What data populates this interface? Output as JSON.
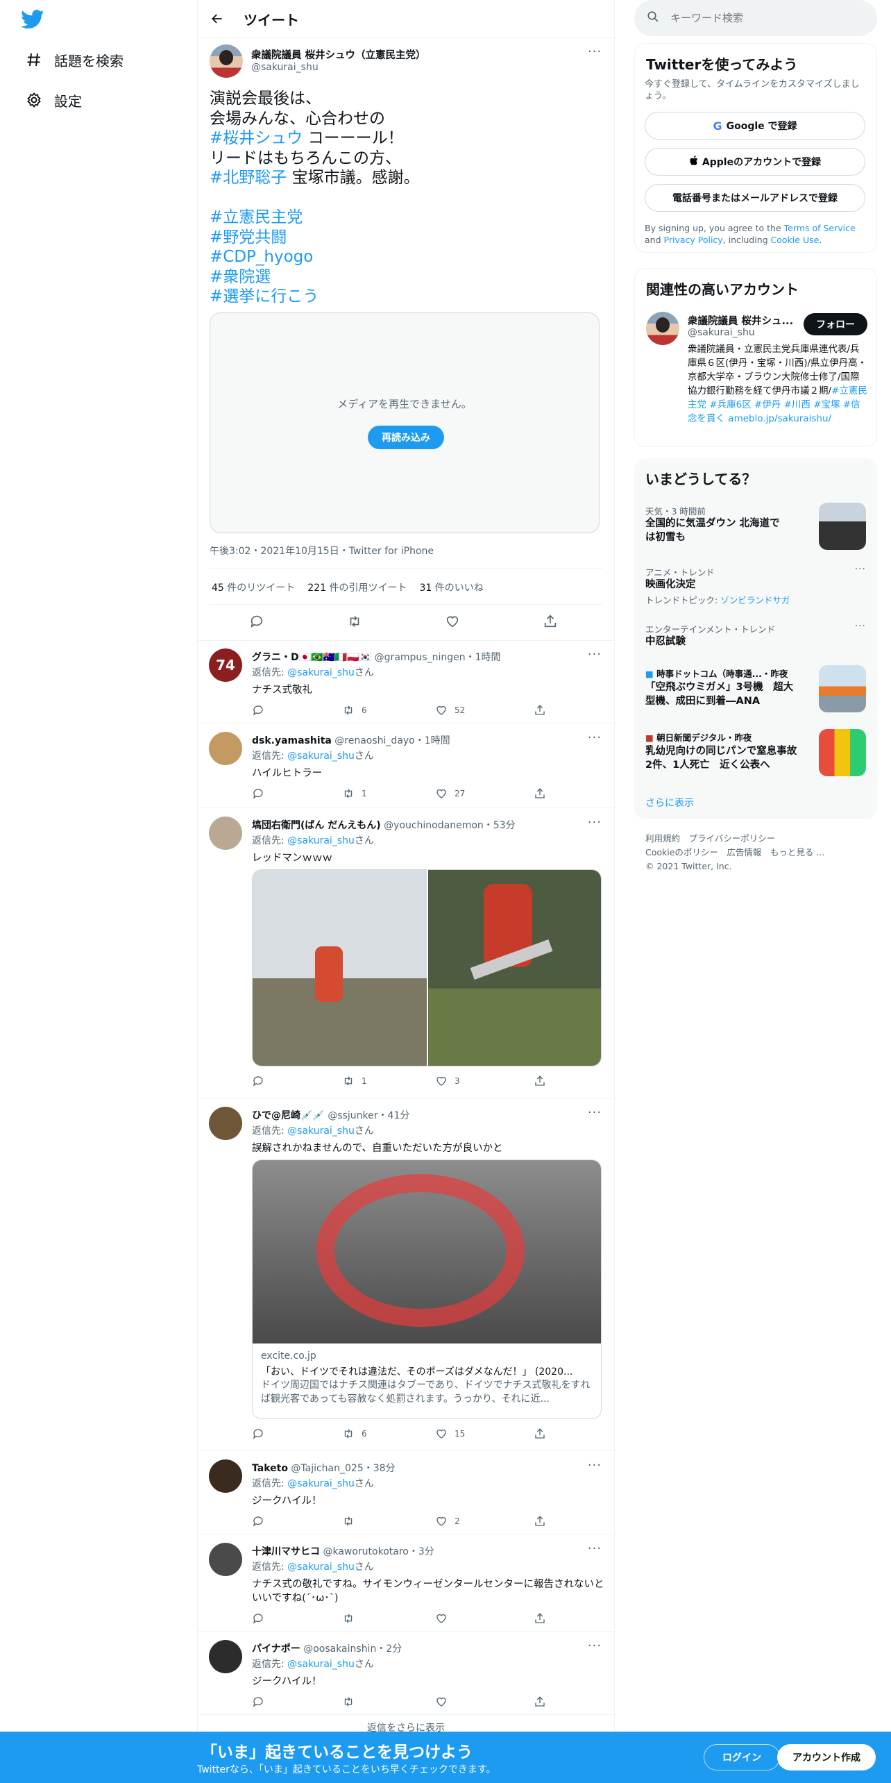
{
  "colors": {
    "brand": "#1d9bf0",
    "text": "#0f1419",
    "muted": "#536471",
    "bar": "#1d9bf0"
  },
  "nav": {
    "logo_icon": "twitter-bird-icon",
    "items": [
      {
        "icon": "hashtag-icon",
        "label": "話題を検索"
      },
      {
        "icon": "gear-icon",
        "label": "設定"
      }
    ]
  },
  "header": {
    "title": "ツイート",
    "back_icon": "arrow-left-icon"
  },
  "tweet": {
    "name": "衆議院議員 桜井シュウ（立憲民主党）",
    "handle": "@sakurai_shu",
    "body": [
      [
        {
          "t": "演説会最後は、"
        }
      ],
      [
        {
          "t": "会場みんな、心合わせの"
        }
      ],
      [
        {
          "t": "#桜井シュウ",
          "l": true
        },
        {
          "t": " コーーール！"
        }
      ],
      [
        {
          "t": "リードはもちろんこの方、"
        }
      ],
      [
        {
          "t": "#北野聡子",
          "l": true
        },
        {
          "t": " 宝塚市議。感謝。"
        }
      ],
      [
        {
          "t": ""
        }
      ],
      [
        {
          "t": "#立憲民主党",
          "l": true
        }
      ],
      [
        {
          "t": "#野党共闘",
          "l": true
        }
      ],
      [
        {
          "t": "#CDP_hyogo",
          "l": true
        }
      ],
      [
        {
          "t": "#衆院選",
          "l": true
        }
      ],
      [
        {
          "t": "#選挙に行こう",
          "l": true
        }
      ]
    ],
    "media_message": "メディアを再生できません。",
    "reload_label": "再読み込み",
    "meta": "午後3:02・2021年10月15日・Twitter for iPhone",
    "retweets": "45",
    "retweets_label": "件のリツイート",
    "quotes": "221",
    "quotes_label": "件の引用ツイート",
    "likes": "31",
    "likes_label": "件のいいね"
  },
  "replies": [
    {
      "name": "グラニ・D",
      "badges": "🇯🇵🇧🇷🇦🇺🇮🇹🇵🇱🇰🇷",
      "handle": "@grampus_ningen",
      "time": "・1時間",
      "reply_prefix": "返信先: ",
      "reply_to": "@sakurai_shu",
      "reply_suffix": "さん",
      "text": "ナチス式敬礼",
      "retweets": "6",
      "likes": "52"
    },
    {
      "name": "dsk.yamashita",
      "badges": "",
      "handle": "@renaoshi_dayo",
      "time": "・1時間",
      "reply_prefix": "返信先: ",
      "reply_to": "@sakurai_shu",
      "reply_suffix": "さん",
      "text": "ハイルヒトラー",
      "retweets": "1",
      "likes": "27"
    },
    {
      "name": "塙団右衛門(ばん だんえもん)",
      "badges": "",
      "handle": "@youchinodanemon",
      "time": "・53分",
      "reply_prefix": "返信先: ",
      "reply_to": "@sakurai_shu",
      "reply_suffix": "さん",
      "text": "レッドマンｗｗｗ",
      "retweets": "1",
      "likes": "3"
    },
    {
      "name": "ひで@尼崎",
      "badges": "💉💉",
      "handle": "@ssjunker",
      "time": "・41分",
      "reply_prefix": "返信先: ",
      "reply_to": "@sakurai_shu",
      "reply_suffix": "さん",
      "text": "誤解されかねませんので、自重いただいた方が良いかと",
      "retweets": "6",
      "likes": "15",
      "card": {
        "domain": "excite.co.jp",
        "title": "「おい、ドイツでそれは違法だ、そのポーズはダメなんだ！」 (2020...",
        "desc": "ドイツ周辺国ではナチス関連はタブーであり、ドイツでナチス式敬礼をすれば観光客であっても容赦なく処罰されます。うっかり、それに近..."
      }
    },
    {
      "name": "Taketo",
      "badges": "",
      "handle": "@Tajichan_025",
      "time": "・38分",
      "reply_prefix": "返信先: ",
      "reply_to": "@sakurai_shu",
      "reply_suffix": "さん",
      "text": "ジークハイル！",
      "retweets": "",
      "likes": "2"
    },
    {
      "name": "十津川マサヒコ",
      "badges": "",
      "handle": "@kaworutokotaro",
      "time": "・3分",
      "reply_prefix": "返信先: ",
      "reply_to": "@sakurai_shu",
      "reply_suffix": "さん",
      "text": "ナチス式の敬礼ですね。サイモンウィーゼンタールセンターに報告されないといいですね(´･ω･`)",
      "retweets": "",
      "likes": ""
    },
    {
      "name": "パイナポー",
      "badges": "",
      "handle": "@oosakainshin",
      "time": "・2分",
      "reply_prefix": "返信先: ",
      "reply_to": "@sakurai_shu",
      "reply_suffix": "さん",
      "text": "ジークハイル！",
      "retweets": "",
      "likes": ""
    }
  ],
  "more_replies_label": "返信をさらに表示",
  "search": {
    "placeholder": "キーワード検索"
  },
  "signup_card": {
    "title": "Twitterを使ってみよう",
    "subtitle": "今すぐ登録して、タイムラインをカスタマイズしましょう。",
    "google_label": "Google で登録",
    "apple_label": "Appleのアカウントで登録",
    "phone_label": "電話番号またはメールアドレスで登録",
    "legal_prefix": "By signing up, you agree to the ",
    "terms": "Terms of Service",
    "legal_and": " and ",
    "privacy": "Privacy Policy",
    "legal_incl": ", including ",
    "cookie": "Cookie Use",
    "legal_end": "."
  },
  "related": {
    "title": "関連性の高いアカウント",
    "name": "衆議院議員 桜井シュ...",
    "handle": "@sakurai_shu",
    "follow_label": "フォロー",
    "bio_text": "衆議院議員・立憲民主党兵庫県連代表/兵庫県６区(伊丹・宝塚・川西)/県立伊丹高・京都大学卒・ブラウン大院修士修了/国際協力銀行勤務を経て伊丹市議２期/",
    "bio_links": "#立憲民主党 #兵庫6区 #伊丹 #川西 #宝塚 #信念を貫く ameblo.jp/sakuraishu/"
  },
  "trends": {
    "title": "いまどうしてる？",
    "items": [
      {
        "category": "天気・3 時間前",
        "title": "全国的に気温ダウン 北海道では初雪も"
      },
      {
        "category": "アニメ・トレンド",
        "title": "映画化決定",
        "topic_prefix": "トレンドトピック: ",
        "topic": "ゾンビランドサガ"
      },
      {
        "category": "エンターテインメント・トレンド",
        "title": "中忍試験"
      },
      {
        "category": "時事ドットコム（時事通...・昨夜",
        "title": "「空飛ぶウミガメ」3号機　超大型機、成田に到着―ANA"
      },
      {
        "category": "朝日新聞デジタル・昨夜",
        "title": "乳幼児向けの同じパンで窒息事故2件、1人死亡　近く公表へ"
      }
    ],
    "show_more": "さらに表示"
  },
  "footer": {
    "line1": "利用規約　プライバシーポリシー",
    "line2": "Cookieのポリシー　広告情報　もっと見る ...",
    "line3": "© 2021 Twitter, Inc."
  },
  "bottom": {
    "headline": "「いま」起きていることを見つけよう",
    "sub": "Twitterなら、「いま」起きていることをいち早くチェックできます。",
    "login": "ログイン",
    "signup": "アカウント作成"
  }
}
